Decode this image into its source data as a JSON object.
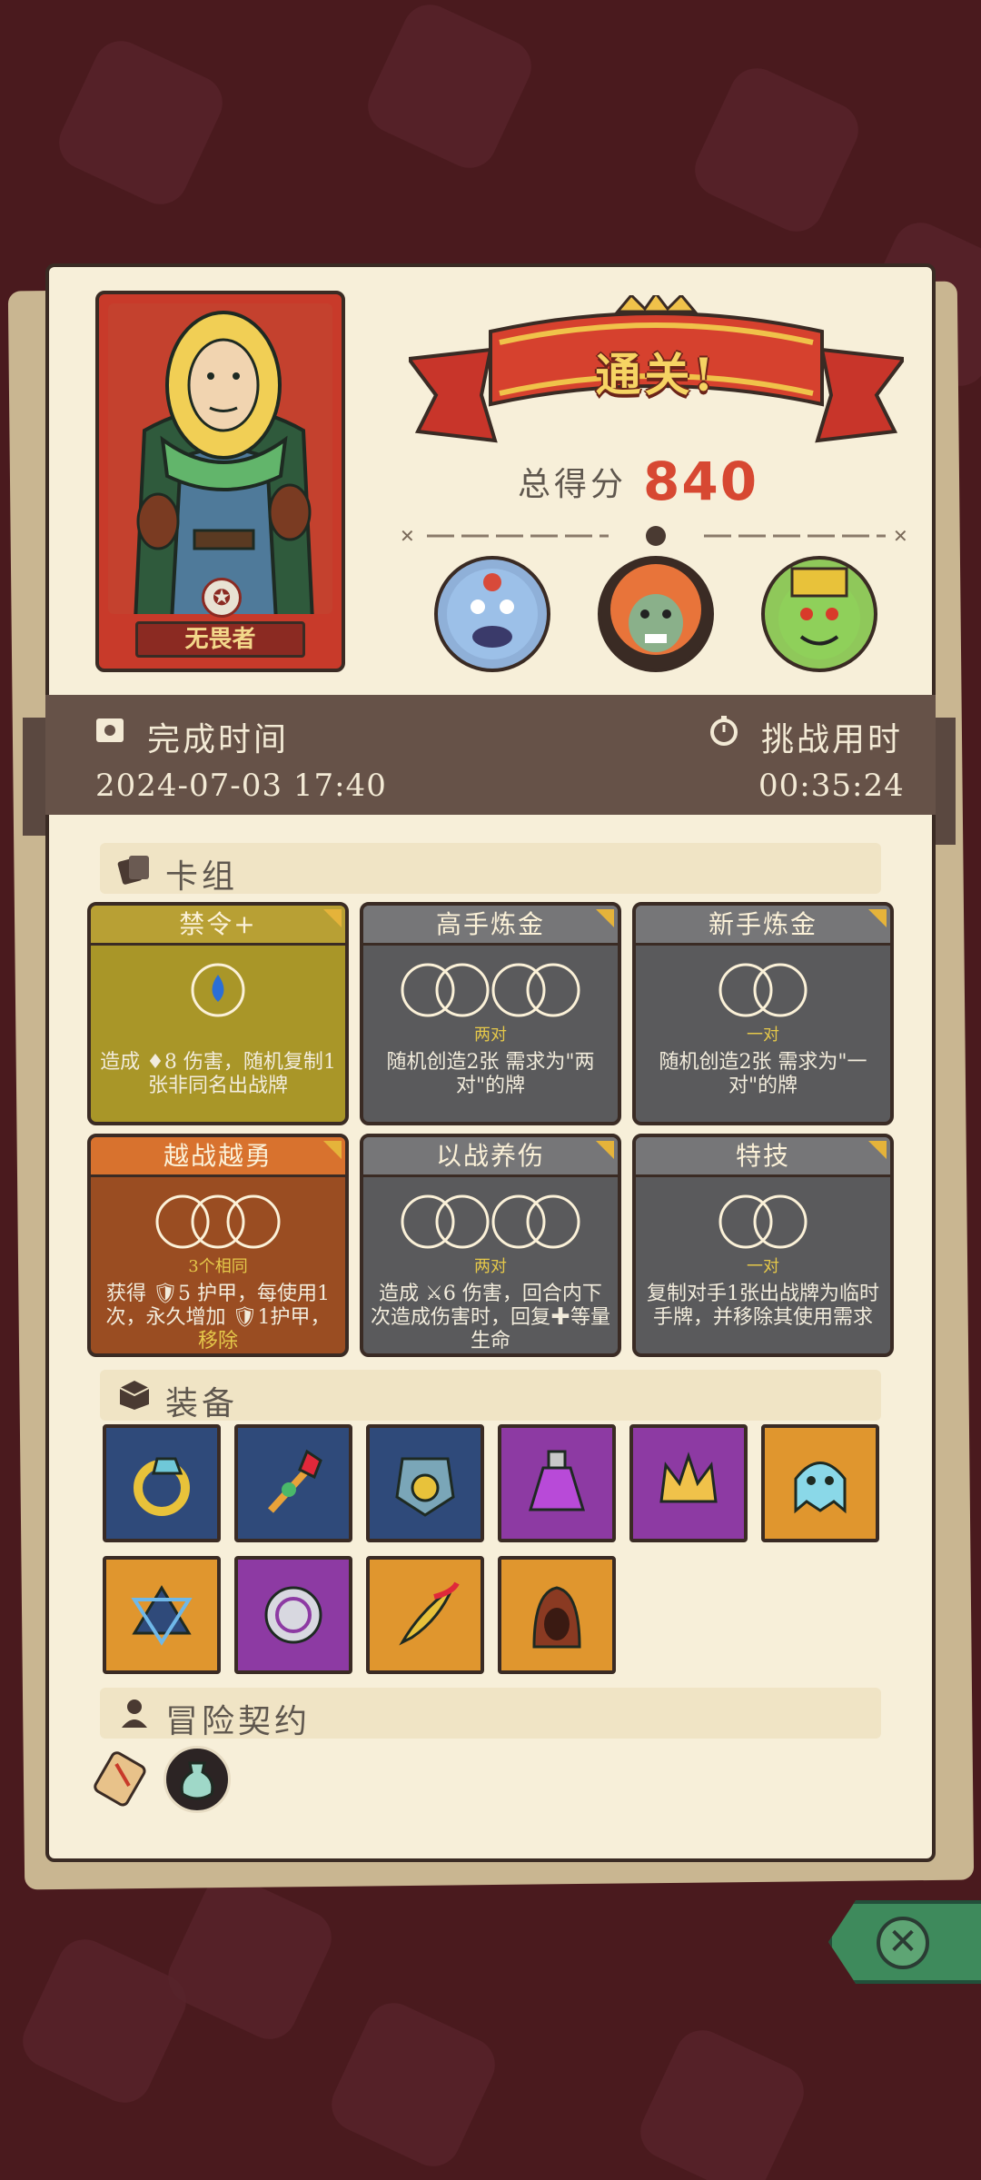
{
  "hero": {
    "name": "无畏者"
  },
  "result": {
    "banner": "通关!",
    "score_label": "总得分",
    "score_value": "840"
  },
  "bosses": [
    {
      "name": "blue-ogre-boss",
      "color": "#8fb0d8"
    },
    {
      "name": "orange-orc-boss",
      "color": "#e8743a"
    },
    {
      "name": "green-goblin-boss",
      "color": "#8fc85a"
    }
  ],
  "times": {
    "finish_label": "完成时间",
    "finish_value": "2024-07-03  17:40",
    "duration_label": "挑战用时",
    "duration_value": "00:35:24"
  },
  "deck": {
    "title": "卡组",
    "cards": [
      {
        "name": "禁令+",
        "style": "gold",
        "slots": 1,
        "req": "",
        "desc": "造成 ♦8 伤害，随机复制1张非同名出战牌"
      },
      {
        "name": "高手炼金",
        "style": "gray",
        "slots": 4,
        "req": "两对",
        "desc": "随机创造2张 需求为\"两对\"的牌"
      },
      {
        "name": "新手炼金",
        "style": "gray",
        "slots": 2,
        "req": "一对",
        "desc": "随机创造2张 需求为\"一对\"的牌"
      },
      {
        "name": "越战越勇",
        "style": "orange",
        "slots": 3,
        "req": "3个相同",
        "desc": "获得 🛡5 护甲，每使用1次，永久增加 🛡1护甲，",
        "desc_extra": "移除"
      },
      {
        "name": "以战养伤",
        "style": "gray",
        "slots": 4,
        "req": "两对",
        "desc": "造成 ⚔6 伤害，回合内下次造成伤害时，回复✚等量生命"
      },
      {
        "name": "特技",
        "style": "gray",
        "slots": 2,
        "req": "一对",
        "desc": "复制对手1张出战牌为临时手牌，并移除其使用需求"
      }
    ]
  },
  "equipment": {
    "title": "装备",
    "items": [
      {
        "name": "ring",
        "bg": "blue"
      },
      {
        "name": "ruby-scepter",
        "bg": "blue"
      },
      {
        "name": "armor-chestplate",
        "bg": "blue"
      },
      {
        "name": "potion-flask",
        "bg": "purple"
      },
      {
        "name": "crown",
        "bg": "purple"
      },
      {
        "name": "ghost-slime",
        "bg": "orange"
      },
      {
        "name": "hexagram-amulet",
        "bg": "orange"
      },
      {
        "name": "rune-shield",
        "bg": "purple"
      },
      {
        "name": "phoenix-feather",
        "bg": "orange"
      },
      {
        "name": "hood",
        "bg": "orange"
      }
    ]
  },
  "contract": {
    "title": "冒险契约",
    "items": [
      {
        "name": "scroll"
      },
      {
        "name": "potion-medal"
      }
    ]
  },
  "close_label": "✕"
}
